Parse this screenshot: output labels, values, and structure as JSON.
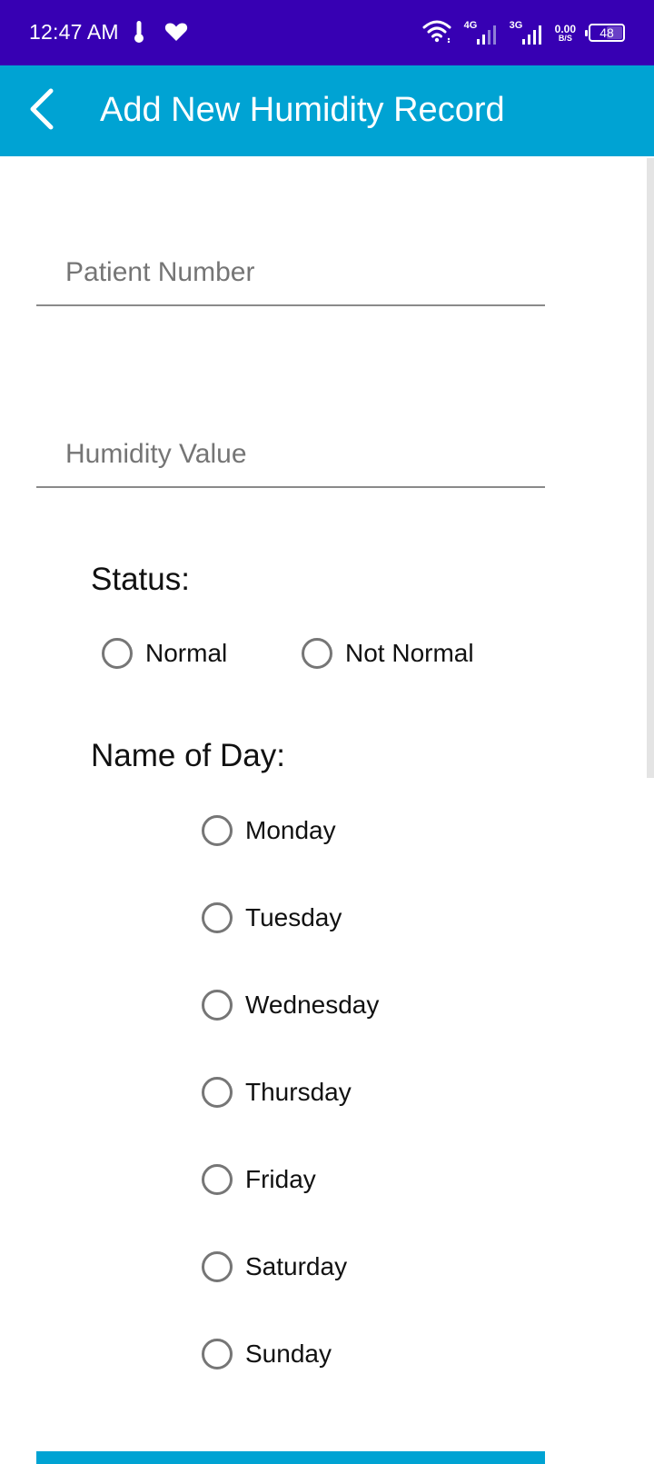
{
  "status_bar": {
    "time": "12:47 AM",
    "icons": [
      "thermometer-icon",
      "heart-icon",
      "wifi-icon",
      "signal-4g-icon",
      "signal-3g-icon"
    ],
    "network_1": "4G",
    "network_2": "3G",
    "speed_value": "0.00",
    "speed_unit": "B/S",
    "battery": "48",
    "battery_level": 0.48
  },
  "app_bar": {
    "title": "Add New Humidity Record",
    "back_icon": "back-arrow-icon"
  },
  "form": {
    "patient_number_placeholder": "Patient Number",
    "humidity_value_placeholder": "Humidity Value",
    "status_label": "Status:",
    "status_options": [
      "Normal",
      "Not Normal"
    ],
    "day_label": "Name of Day:",
    "days": [
      "Monday",
      "Tuesday",
      "Wednesday",
      "Thursday",
      "Friday",
      "Saturday",
      "Sunday"
    ]
  },
  "colors": {
    "status_bar": "#3700b3",
    "app_bar": "#00a3d3",
    "radio_border": "#767676"
  }
}
